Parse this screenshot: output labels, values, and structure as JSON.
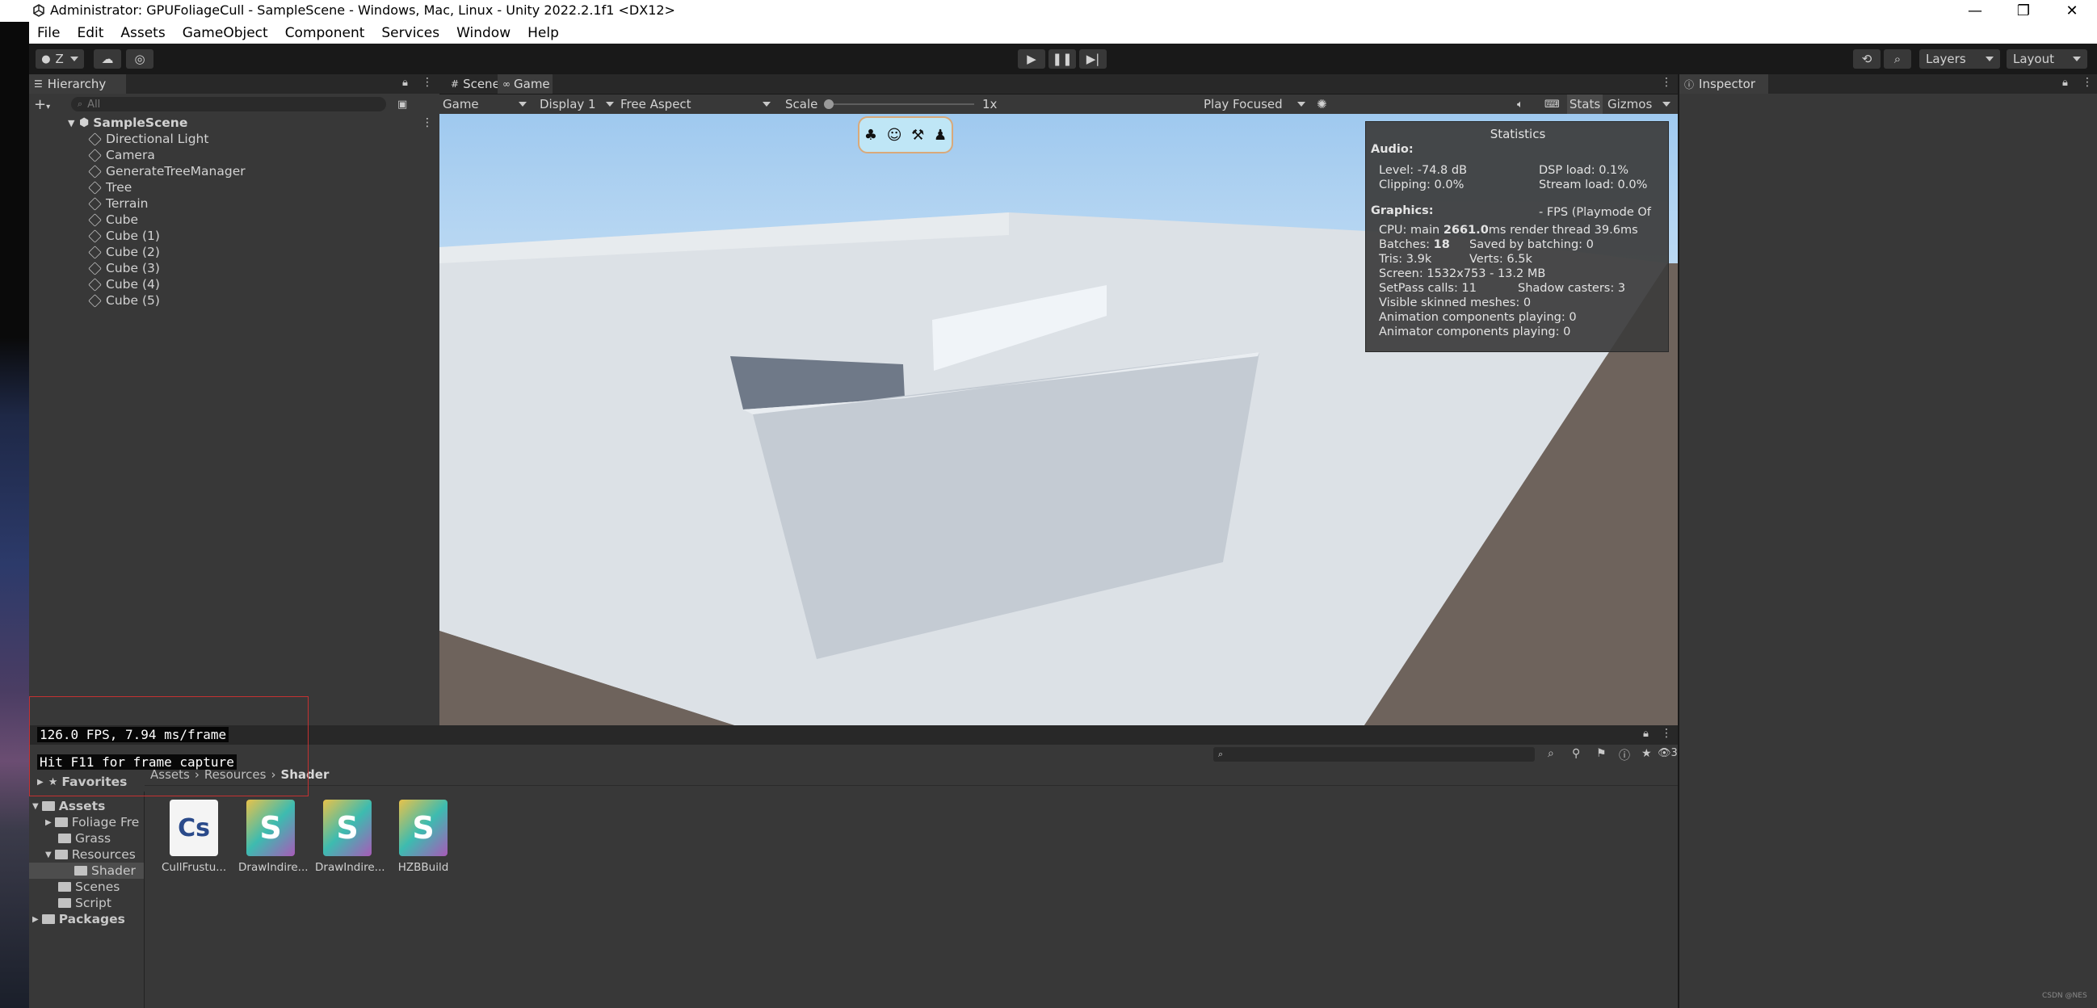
{
  "window": {
    "title": "Administrator: GPUFoliageCull - SampleScene - Windows, Mac, Linux - Unity 2022.2.1f1 <DX12>"
  },
  "menu": [
    "File",
    "Edit",
    "Assets",
    "GameObject",
    "Component",
    "Services",
    "Window",
    "Help"
  ],
  "toolbar": {
    "account": "Z",
    "layers": "Layers",
    "layout": "Layout"
  },
  "hierarchy": {
    "tab": "Hierarchy",
    "search_placeholder": "All",
    "scene": "SampleScene",
    "items": [
      "Directional Light",
      "Camera",
      "GenerateTreeManager",
      "Tree",
      "Terrain",
      "Cube",
      "Cube (1)",
      "Cube (2)",
      "Cube (3)",
      "Cube (4)",
      "Cube (5)"
    ]
  },
  "center": {
    "tabs": [
      "Scene",
      "Game"
    ],
    "game_dropdown": "Game",
    "display": "Display 1",
    "aspect": "Free Aspect",
    "scale_label": "Scale",
    "scale_value": "1x",
    "play_mode": "Play Focused",
    "stats_button": "Stats",
    "gizmos": "Gizmos"
  },
  "stats": {
    "title": "Statistics",
    "audio_header": "Audio:",
    "level": "Level: -74.8 dB",
    "dsp": "DSP load: 0.1%",
    "clipping": "Clipping: 0.0%",
    "stream": "Stream load: 0.0%",
    "graphics_header": "Graphics:",
    "fps_note": "- FPS (Playmode Of",
    "cpu_prefix": "CPU: main ",
    "cpu_value": "2661.0",
    "cpu_suffix": "ms  render thread 39.6ms",
    "batches_prefix": "Batches: ",
    "batches_value": "18",
    "saved": "Saved by batching: 0",
    "tris": "Tris: 3.9k",
    "verts": "Verts: 6.5k",
    "screen": "Screen: 1532x753 - 13.2 MB",
    "setpass": "SetPass calls: 11",
    "shadow": "Shadow casters: 3",
    "skinned": "Visible skinned meshes: 0",
    "anim": "Animation components playing: 0",
    "animator": "Animator components playing: 0"
  },
  "inspector": {
    "tab": "Inspector"
  },
  "project": {
    "favorites": "Favorites",
    "breadcrumb": [
      "Assets",
      "Resources",
      "Shader"
    ],
    "tree": [
      "Assets",
      "Foliage Fre",
      "Grass",
      "Resources",
      "Shader",
      "Scenes",
      "Script",
      "Packages"
    ],
    "hidden_count": "3",
    "assets": [
      {
        "label": "CullFrustu...",
        "glyph": "Cs"
      },
      {
        "label": "DrawIndire...",
        "glyph": "S"
      },
      {
        "label": "DrawIndire...",
        "glyph": "S"
      },
      {
        "label": "HZBBuild",
        "glyph": "S"
      }
    ]
  },
  "overlay": {
    "fps": "126.0 FPS, 7.94 ms/frame",
    "hint": "Hit F11 for frame capture"
  },
  "watermark": "CSDN @NES"
}
